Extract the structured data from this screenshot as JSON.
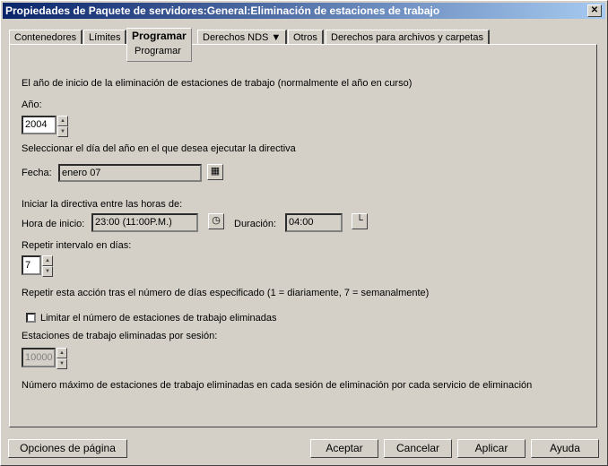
{
  "window": {
    "title": "Propiedades de Paquete de servidores:General:Eliminación de estaciones de trabajo",
    "close": "✕"
  },
  "tabs": [
    {
      "label": "Contenedores"
    },
    {
      "label": "Límites"
    },
    {
      "label": "Programar",
      "sub": "Programar"
    },
    {
      "label": "Derechos NDS ▼"
    },
    {
      "label": "Otros"
    },
    {
      "label": "Derechos para archivos y carpetas"
    }
  ],
  "form": {
    "intro": "El año de inicio de la eliminación de estaciones de trabajo (normalmente el año en curso)",
    "year_label": "Año:",
    "year_value": "2004",
    "day_text": "Seleccionar el día del año en el que desea ejecutar la directiva",
    "date_label": "Fecha:",
    "date_value": "enero 07",
    "hours_text": "Iniciar la directiva entre las horas de:",
    "start_label": "Hora de inicio:",
    "start_value": "23:00 (11:00P.M.)",
    "duration_label": "Duración:",
    "duration_value": "04:00",
    "repeat_label": "Repetir intervalo en días:",
    "repeat_value": "7",
    "repeat_desc": "Repetir esta acción tras el número de días especificado (1 = diariamente, 7 = semanalmente)",
    "limit_label": "Limitar el número de estaciones de trabajo eliminadas",
    "limit_checked": false,
    "per_session_label": "Estaciones de trabajo eliminadas por sesión:",
    "per_session_value": "10000",
    "max_desc": "Número máximo de estaciones de trabajo eliminadas en cada sesión de eliminación por cada servicio de eliminación"
  },
  "buttons": {
    "page_options": "Opciones de página",
    "accept": "Aceptar",
    "cancel": "Cancelar",
    "apply": "Aplicar",
    "help": "Ayuda"
  }
}
